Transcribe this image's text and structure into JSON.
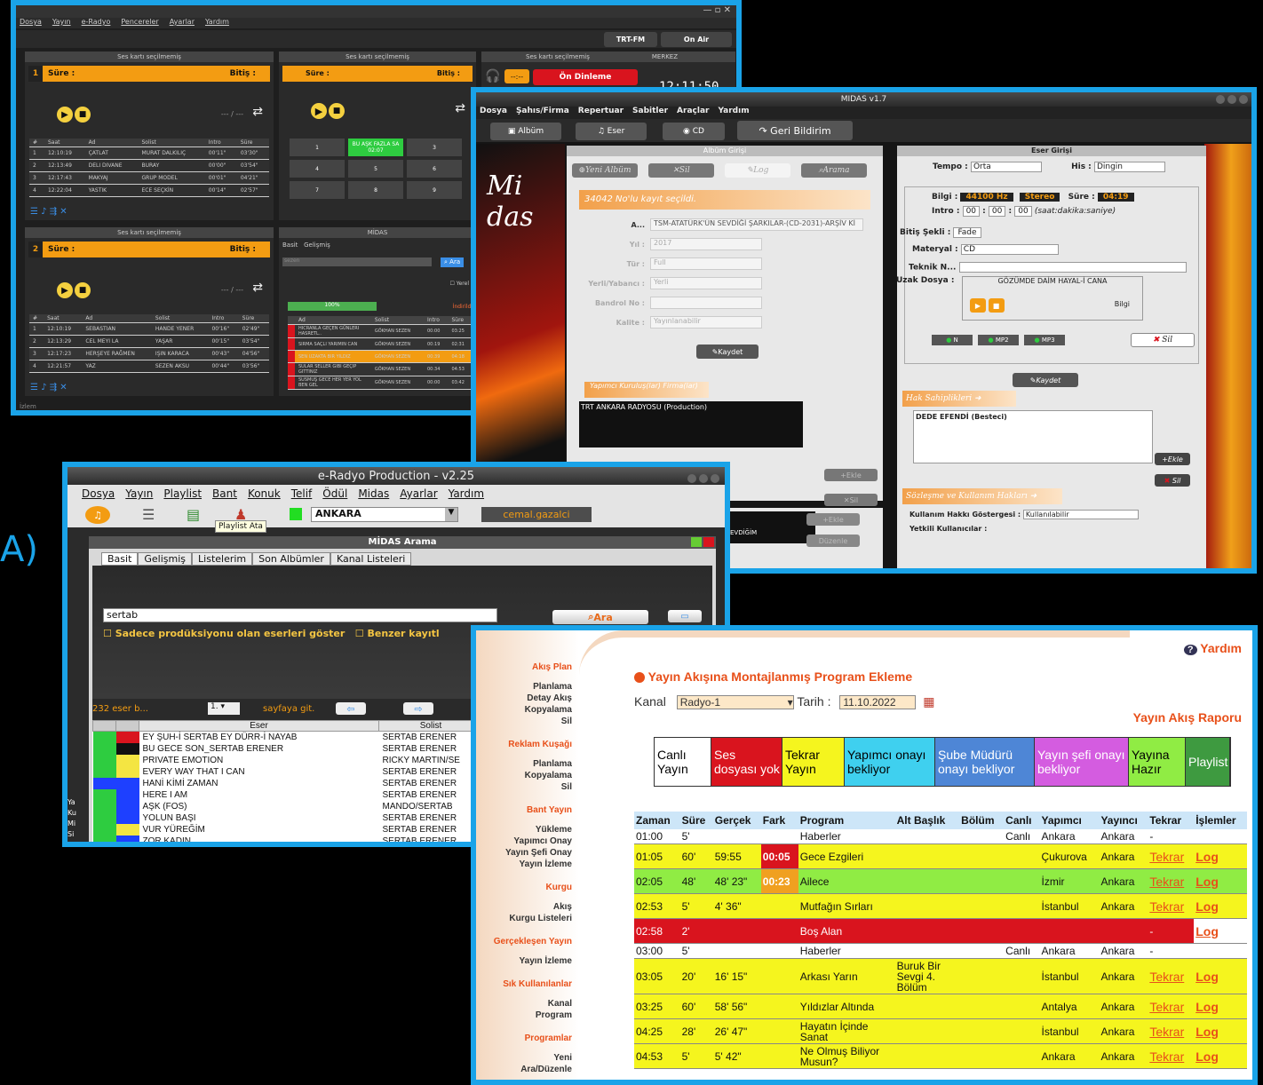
{
  "label_a": "A)",
  "w1": {
    "menu": [
      "Dosya",
      "Yayın",
      "e-Radyo",
      "Pencereler",
      "Ayarlar",
      "Yardım"
    ],
    "channel": "TRT-FM",
    "onair": "On Air",
    "card_title": "Ses kartı seçilmemiş",
    "merkez": "MERKEZ",
    "on_dinleme": "Ön Dinleme",
    "clock": "12:11:50",
    "sure": "Süre :",
    "bitis": "Bitiş :",
    "time_placeholder": "--- / ---",
    "cols": [
      "#",
      "Saat",
      "Ad",
      "Solist",
      "Intro",
      "Süre"
    ],
    "p1_rows": [
      [
        "1",
        "12:10:19",
        "ÇATLAT",
        "MURAT DALKILIÇ",
        "00'11\"",
        "03'30\""
      ],
      [
        "2",
        "12:13:49",
        "DELI DIVANE",
        "BURAY",
        "00'00\"",
        "03'54\""
      ],
      [
        "3",
        "12:17:43",
        "MAKYAJ",
        "GRUP MODEL",
        "00'01\"",
        "04'21\""
      ],
      [
        "4",
        "12:22:04",
        "YASTIK",
        "ECE SEÇKİN",
        "00'14\"",
        "02'57\""
      ]
    ],
    "p2_rows": [
      [
        "1",
        "12:10:19",
        "SEBASTIAN",
        "HANDE YENER",
        "00'16\"",
        "02'49\""
      ],
      [
        "2",
        "12:13:29",
        "CEL MEYI LA",
        "YAŞAR",
        "00'15\"",
        "03'54\""
      ],
      [
        "3",
        "12:17:23",
        "HERŞEYE RAĞMEN",
        "IŞIN KARACA",
        "00'43\"",
        "04'56\""
      ],
      [
        "4",
        "12:21:57",
        "YAZ",
        "SEZEN AKSU",
        "00'44\"",
        "03'56\""
      ]
    ],
    "cart_keys": [
      "1",
      "BU AŞK FAZLA SA 02:07",
      "3",
      "4",
      "5",
      "6",
      "7",
      "8",
      "9"
    ],
    "midas_title": "MİDAS",
    "midas_tabs": [
      "Basit",
      "Gelişmiş"
    ],
    "midas_search": "sezen",
    "midas_ara": "Ara",
    "midas_yerel": "Yerel",
    "midas_progress": "100%",
    "midas_indirildi": "İndirildi",
    "midas_cols": [
      "Ad",
      "Solist",
      "Intro",
      "Süre"
    ],
    "midas_rows": [
      [
        "HICRANLA GEÇEN GÜNLERI HASRETL..",
        "GÖKHAN SEZEN",
        "00:00",
        "03:25"
      ],
      [
        "SIRMA SAÇLI YARIMIN CAN",
        "GÖKHAN SEZEN",
        "00:19",
        "02:31"
      ],
      [
        "SEN UZAKTA BIR YILDIZ",
        "GÖKHAN SEZEN",
        "00:39",
        "04:18"
      ],
      [
        "SULAR SELLER GIBI GEÇIP GITTINIZ",
        "GÖKHAN SEZEN",
        "00:34",
        "04:53"
      ],
      [
        "SUSMUŞ GECE HER YER YOL BEN GEL",
        "GÖKHAN SEZEN",
        "00:00",
        "03:42"
      ]
    ],
    "status": "İzlem"
  },
  "w2": {
    "title": "MIDAS v1.7",
    "menu": [
      "Dosya",
      "Şahıs/Firma",
      "Repertuar",
      "Sabitler",
      "Araçlar",
      "Yardım"
    ],
    "tools": [
      "Albüm",
      "Eser",
      "CD",
      "Geri Bildirim"
    ],
    "album_title": "Albüm Girişi",
    "album_btns": [
      "Yeni Albüm",
      "Sil",
      "Log",
      "Arama"
    ],
    "selected": "34042 No'lu kayıt seçildi.",
    "fields": [
      {
        "label": "A...",
        "value": "TSM-ATATÜRK'ÜN SEVDİĞİ ŞARKILAR-(CD-2031)-ARŞİV Kİ"
      },
      {
        "label": "Yıl :",
        "value": "2017"
      },
      {
        "label": "Tür :",
        "value": "Full"
      },
      {
        "label": "Yerli/Yabancı :",
        "value": "Yerli"
      },
      {
        "label": "Bandrol No :",
        "value": ""
      },
      {
        "label": "Kalite :",
        "value": "Yayınlanabilir"
      }
    ],
    "kaydet": "Kaydet",
    "yapimci_title": "Yapımcı Kuruluş(lar) Firma(lar)",
    "yapimci_value": "TRT ANKARA RADYOSU (Production)",
    "ekle": "Ekle",
    "sil": "Sil",
    "duzenle": "Düzenle",
    "sevdigim": "EVDİĞİM",
    "eser_title": "Eser Girişi",
    "tempo_label": "Tempo :",
    "tempo": "Orta",
    "his_label": "His :",
    "his": "Dingin",
    "bilgi_label": "Bilgi :",
    "hz": "44100 Hz",
    "stereo": "Stereo",
    "sure_label": "Süre :",
    "sure": "04:19",
    "intro_label": "Intro :",
    "intro_vals": [
      "00",
      "00",
      "00"
    ],
    "intro_hint": "(saat:dakika:saniye)",
    "bitis_label": "Bitiş Şekli :",
    "bitis": "Fade",
    "materyal_label": "Materyal :",
    "materyal": "CD",
    "teknik_label": "Teknik N...",
    "uzak_label": "Uzak Dosya :",
    "uzak_song": "GÖZÜMDE DAİM HAYAL-İ CANA",
    "bilgi_small": "Bilgi",
    "formats": [
      "N",
      "MP2",
      "MP3"
    ],
    "hak_title": "Hak Sahiplikleri",
    "hak_value": "DEDE EFENDİ (Besteci)",
    "sozlesme_title": "Sözleşme ve Kullanım Hakları",
    "kullanim_label": "Kullanım Hakkı Göstergesi :",
    "kullanim": "Kullanılabilir",
    "yetkili_label": "Yetkili Kullanıcılar :"
  },
  "w3": {
    "title": "e-Radyo Production - v2.25",
    "menu": [
      "Dosya",
      "Yayın",
      "Playlist",
      "Bant",
      "Konuk",
      "Telif",
      "Ödül",
      "Midas",
      "Ayarlar",
      "Yardım"
    ],
    "station": "ANKARA",
    "user": "cemal.gazalci",
    "tooltip": "Playlist Ata",
    "search_title": "MİDAS Arama",
    "tabs": [
      "Basit",
      "Gelişmiş",
      "Listelerim",
      "Son Albümler",
      "Kanal Listeleri"
    ],
    "query": "sertab",
    "ara": "Ara",
    "chk1": "Sadece prodüksiyonu olan eserleri göster",
    "chk2": "Benzer kayıtl",
    "count": "232 eser b...",
    "page": "1.",
    "sayfaya": "sayfaya git.",
    "cols": [
      "Eser",
      "Solist"
    ],
    "rows": [
      [
        "EY ŞUH-İ SERTAB EY DÜRR-İ NAYAB",
        "SERTAB ERENER"
      ],
      [
        "BU GECE SON_SERTAB ERENER",
        "SERTAB ERENER"
      ],
      [
        "PRIVATE EMOTION",
        "RICKY MARTIN/SE"
      ],
      [
        "EVERY WAY THAT I CAN",
        "SERTAB ERENER"
      ],
      [
        "HANİ KİMİ ZAMAN",
        "SERTAB ERENER"
      ],
      [
        "HERE I AM",
        "SERTAB ERENER"
      ],
      [
        "AŞK (FOS)",
        "MANDO/SERTAB"
      ],
      [
        "YOLUN BAŞI",
        "SERTAB ERENER"
      ],
      [
        "VUR YÜREĞİM",
        "SERTAB ERENER"
      ],
      [
        "ZOR KADIN",
        "SERTAB ERENER"
      ]
    ],
    "side": [
      "Ya",
      "Ku",
      "Mi",
      "Si"
    ]
  },
  "w4": {
    "yardim": "Yardım",
    "nav": [
      {
        "h": "Akış Plan",
        "items": [
          "Planlama",
          "Detay Akış",
          "Kopyalama",
          "Sil"
        ]
      },
      {
        "h": "Reklam Kuşağı",
        "items": [
          "Planlama",
          "Kopyalama",
          "Sil"
        ]
      },
      {
        "h": "Bant Yayın",
        "items": [
          "Yükleme",
          "Yapımcı Onay",
          "Yayın Şefi Onay",
          "Yayın İzleme"
        ]
      },
      {
        "h": "Kurgu",
        "items": [
          "Akış",
          "Kurgu Listeleri"
        ]
      },
      {
        "h": "Gerçekleşen Yayın",
        "items": [
          "Yayın İzleme"
        ]
      },
      {
        "h": "Sık Kullanılanlar",
        "items": [
          "Kanal",
          "Program"
        ]
      },
      {
        "h": "Programlar",
        "items": [
          "Yeni",
          "Ara/Düzenle"
        ]
      }
    ],
    "heading": "Yayın Akışına Montajlanmış Program Ekleme",
    "kanal_label": "Kanal",
    "kanal": "Radyo-1",
    "tarih_label": "Tarih :",
    "tarih": "11.10.2022",
    "rapor": "Yayın Akış Raporu",
    "legend": [
      {
        "t": "Canlı Yayın",
        "bg": "#ffffff",
        "fg": "#000000"
      },
      {
        "t": "Ses dosyası yok",
        "bg": "#d9141e",
        "fg": "#ffffff"
      },
      {
        "t": "Tekrar Yayın",
        "bg": "#f5f51e",
        "fg": "#000000"
      },
      {
        "t": "Yapımcı onayı bekliyor",
        "bg": "#3fd0ef",
        "fg": "#000000"
      },
      {
        "t": "Şube Müdürü onayı bekliyor",
        "bg": "#4e86d6",
        "fg": "#ffffff"
      },
      {
        "t": "Yayın şefi onayı bekliyor",
        "bg": "#d45ce0",
        "fg": "#ffffff"
      },
      {
        "t": "Yayına Hazır",
        "bg": "#90ec44",
        "fg": "#000000"
      },
      {
        "t": "Playlist",
        "bg": "#3e9a40",
        "fg": "#ffffff"
      }
    ],
    "cols": [
      "Zaman",
      "Süre",
      "Gerçek",
      "Fark",
      "Program",
      "Alt Başlık",
      "Bölüm",
      "Canlı",
      "Yapımcı",
      "Yayıncı",
      "Tekrar",
      "İşlemler"
    ],
    "rows": [
      {
        "c": "w",
        "v": [
          "01:00",
          "5'",
          "",
          "",
          "Haberler",
          "",
          "",
          "Canlı",
          "Ankara",
          "Ankara",
          "-",
          ""
        ]
      },
      {
        "c": "y",
        "v": [
          "01:05",
          "60'",
          "59:55",
          "00:05",
          "Gece Ezgileri",
          "",
          "",
          "",
          "Çukurova",
          "Ankara",
          "Tekrar",
          "Log"
        ],
        "f": "#d9141e"
      },
      {
        "c": "g",
        "v": [
          "02:05",
          "48'",
          "48' 23\"",
          "00:23",
          "Ailece",
          "",
          "",
          "",
          "İzmir",
          "Ankara",
          "Tekrar",
          "Log"
        ],
        "f": "#f0a020"
      },
      {
        "c": "y",
        "v": [
          "02:53",
          "5'",
          "4' 36\"",
          "",
          "Mutfağın Sırları",
          "",
          "",
          "",
          "İstanbul",
          "Ankara",
          "Tekrar",
          "Log"
        ]
      },
      {
        "c": "r",
        "v": [
          "02:58",
          "2'",
          "",
          "",
          "Boş Alan",
          "",
          "",
          "",
          "",
          "",
          "-",
          "Log"
        ]
      },
      {
        "c": "w",
        "v": [
          "03:00",
          "5'",
          "",
          "",
          "Haberler",
          "",
          "",
          "Canlı",
          "Ankara",
          "Ankara",
          "-",
          ""
        ]
      },
      {
        "c": "y",
        "v": [
          "03:05",
          "20'",
          "16' 15\"",
          "",
          "Arkası Yarın",
          "Buruk Bir Sevgi 4. Bölüm",
          "",
          "",
          "İstanbul",
          "Ankara",
          "Tekrar",
          "Log"
        ]
      },
      {
        "c": "y",
        "v": [
          "03:25",
          "60'",
          "58' 56\"",
          "",
          "Yıldızlar Altında",
          "",
          "",
          "",
          "Antalya",
          "Ankara",
          "Tekrar",
          "Log"
        ]
      },
      {
        "c": "y",
        "v": [
          "04:25",
          "28'",
          "26' 47\"",
          "",
          "Hayatın İçinde Sanat",
          "",
          "",
          "",
          "İstanbul",
          "Ankara",
          "Tekrar",
          "Log"
        ]
      },
      {
        "c": "y",
        "v": [
          "04:53",
          "5'",
          "5' 42\"",
          "",
          "Ne Olmuş Biliyor Musun?",
          "",
          "",
          "",
          "Ankara",
          "Ankara",
          "Tekrar",
          "Log"
        ]
      }
    ]
  }
}
